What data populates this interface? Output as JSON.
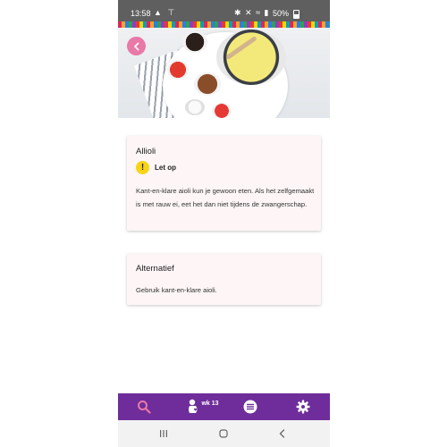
{
  "status": {
    "time": "13:58",
    "battery": "50%"
  },
  "hero": {
    "image_description_icon": "food-photo"
  },
  "cards": [
    {
      "title": "Allioli",
      "warning_label": "Let op",
      "body": "Kant-en-klare aioli kun je gewoon eten. Als het zelfgemaakt is met rauw ei, eet het dan niet tijdens de zwangerschap."
    },
    {
      "title": "Alternatief",
      "body": "Gebruik kant-en-klare aioli."
    }
  ],
  "bottom_nav": {
    "week_label": "wk 13",
    "items": [
      "search-icon",
      "pregnancy-week-icon",
      "list-icon",
      "gear-icon"
    ]
  },
  "colors": {
    "nav_bg": "#6e2d9a",
    "back_button": "#e879a8",
    "card_bg": "#fdf5f6",
    "warning": "#f7d414"
  }
}
